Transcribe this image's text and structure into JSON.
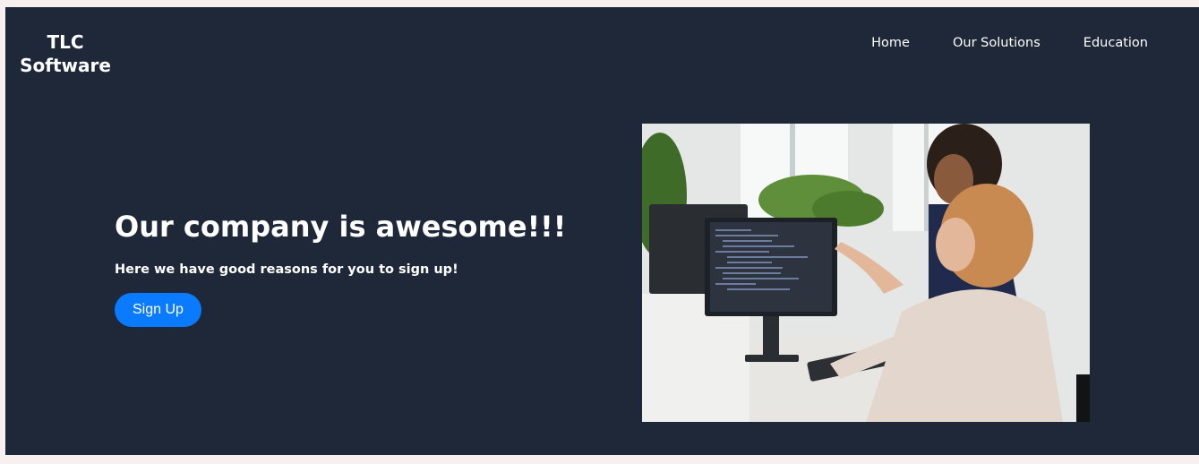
{
  "brand": {
    "line1": "TLC",
    "line2": "Software"
  },
  "nav": {
    "items": [
      {
        "label": "Home"
      },
      {
        "label": "Our Solutions"
      },
      {
        "label": "Education"
      }
    ]
  },
  "hero": {
    "title": "Our company is awesome!!!",
    "subtitle": "Here we have good reasons for you to sign up!",
    "cta_label": "Sign Up",
    "image_icon": "office-photo"
  },
  "colors": {
    "background": "#1f2838",
    "accent": "#0a7bff",
    "text": "#ffffff"
  }
}
